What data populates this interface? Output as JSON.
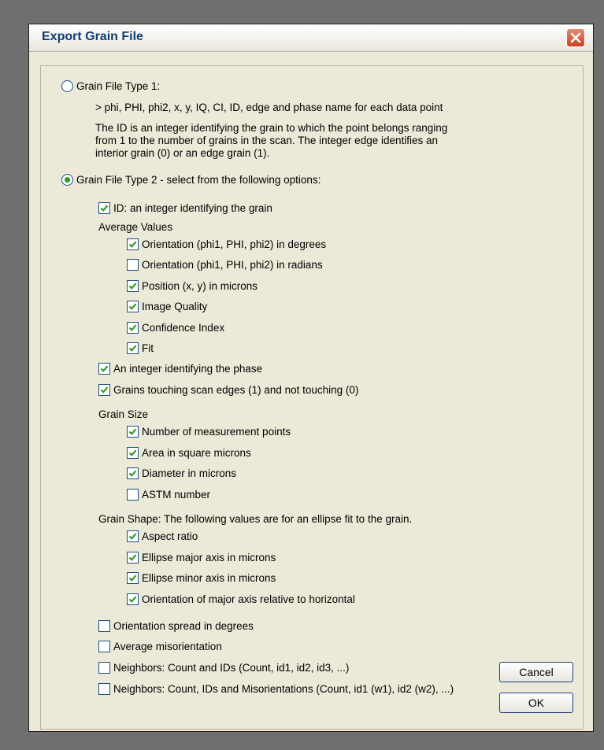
{
  "window": {
    "title": "Export Grain File"
  },
  "type1": {
    "label": "Grain File Type 1:",
    "selected": false,
    "format_line": "> phi, PHI, phi2, x, y, IQ, CI, ID, edge and phase name for each data point",
    "description": [
      "The ID is an integer identifying the grain to which the point belongs ranging",
      "from 1 to the number of grains in the scan. The integer edge identifies an",
      "interior grain (0) or an edge grain (1)."
    ]
  },
  "type2": {
    "label": "Grain File Type 2 - select from the following options:",
    "selected": true
  },
  "options": {
    "id": {
      "label": "ID: an integer identifying the grain",
      "checked": true
    },
    "average_values": {
      "heading": "Average Values",
      "items": [
        {
          "label": "Orientation (phi1, PHI, phi2) in degrees",
          "checked": true
        },
        {
          "label": "Orientation (phi1, PHI, phi2) in radians",
          "checked": false
        },
        {
          "label": "Position (x, y) in microns",
          "checked": true
        },
        {
          "label": "Image Quality",
          "checked": true
        },
        {
          "label": "Confidence Index",
          "checked": true
        },
        {
          "label": "Fit",
          "checked": true
        }
      ]
    },
    "phase": {
      "label": "An integer identifying the phase",
      "checked": true
    },
    "edges": {
      "label": "Grains touching scan edges (1) and not touching (0)",
      "checked": true
    },
    "grain_size": {
      "heading": "Grain Size",
      "items": [
        {
          "label": "Number of measurement points",
          "checked": true
        },
        {
          "label": "Area in square microns",
          "checked": true
        },
        {
          "label": "Diameter in microns",
          "checked": true
        },
        {
          "label": "ASTM number",
          "checked": false
        }
      ]
    },
    "grain_shape": {
      "heading": "Grain Shape: The following values are for an ellipse fit to the grain.",
      "items": [
        {
          "label": "Aspect ratio",
          "checked": true
        },
        {
          "label": "Ellipse major axis in microns",
          "checked": true
        },
        {
          "label": "Ellipse minor axis in microns",
          "checked": true
        },
        {
          "label": "Orientation of major axis relative to horizontal",
          "checked": true
        }
      ]
    },
    "spread": {
      "label": "Orientation spread in degrees",
      "checked": false
    },
    "avg_misorientation": {
      "label": "Average misorientation",
      "checked": false
    },
    "neighbors_ids": {
      "label": "Neighbors: Count and IDs (Count, id1, id2, id3, ...)",
      "checked": false
    },
    "neighbors_mis": {
      "label": "Neighbors: Count, IDs and Misorientations (Count, id1 (w1), id2 (w2), ...)",
      "checked": false
    }
  },
  "buttons": {
    "cancel": "Cancel",
    "ok": "OK"
  },
  "colors": {
    "check": "#2f9a2a",
    "checkbox_border": "#1c5180",
    "dialog_bg": "#ece9d8",
    "title_text": "#123c75"
  }
}
